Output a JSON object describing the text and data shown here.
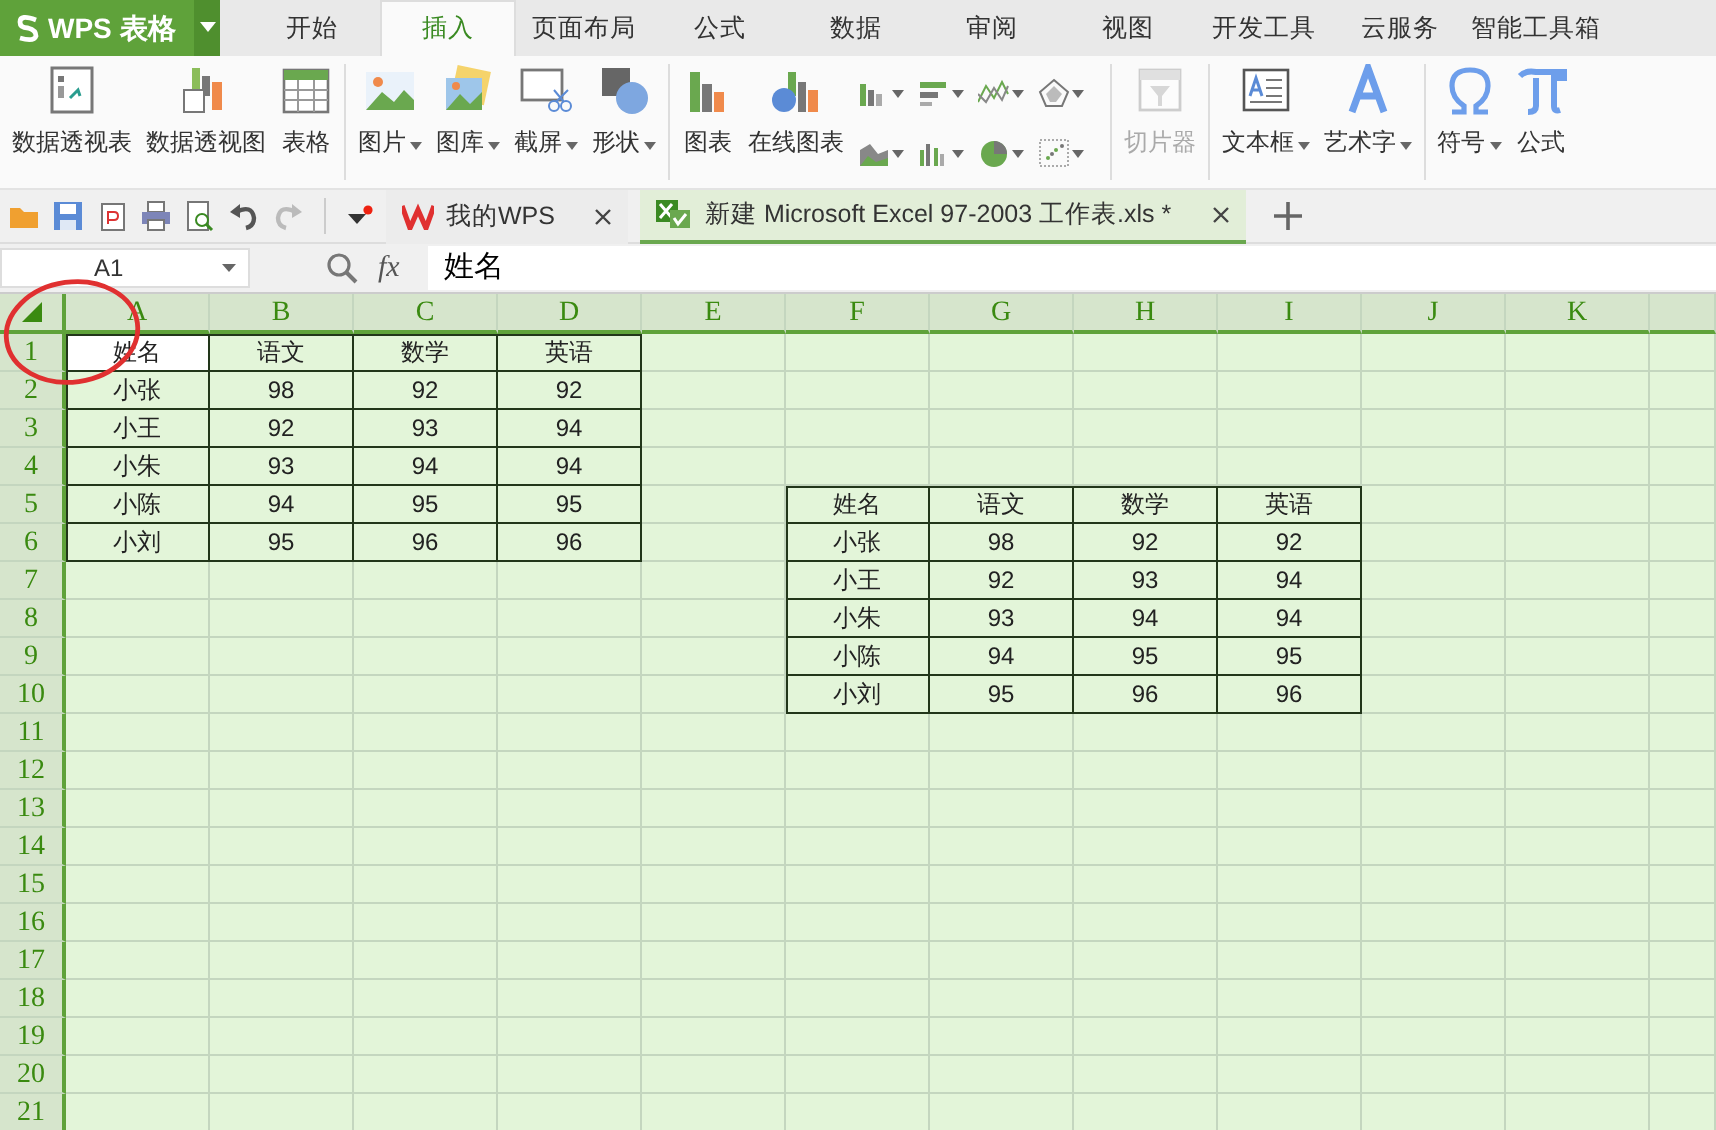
{
  "app_menu": {
    "label": "WPS 表格"
  },
  "ribbon_tabs": [
    {
      "label": "开始",
      "selected": false
    },
    {
      "label": "插入",
      "selected": true
    },
    {
      "label": "页面布局",
      "selected": false
    },
    {
      "label": "公式",
      "selected": false
    },
    {
      "label": "数据",
      "selected": false
    },
    {
      "label": "审阅",
      "selected": false
    },
    {
      "label": "视图",
      "selected": false
    },
    {
      "label": "开发工具",
      "selected": false
    },
    {
      "label": "云服务",
      "selected": false
    },
    {
      "label": "智能工具箱",
      "selected": false
    }
  ],
  "ribbon_groups": [
    {
      "kind": "plain",
      "buttons": [
        {
          "label": "数据透视表",
          "dropdown": false,
          "disabled": false
        },
        {
          "label": "数据透视图",
          "dropdown": false,
          "disabled": false
        },
        {
          "label": "表格",
          "dropdown": false,
          "disabled": false
        }
      ]
    },
    {
      "kind": "plain",
      "buttons": [
        {
          "label": "图片",
          "dropdown": true,
          "disabled": false
        },
        {
          "label": "图库",
          "dropdown": true,
          "disabled": false
        },
        {
          "label": "截屏",
          "dropdown": true,
          "disabled": false
        },
        {
          "label": "形状",
          "dropdown": true,
          "disabled": false
        }
      ]
    },
    {
      "kind": "charts",
      "buttons": [
        {
          "label": "图表",
          "dropdown": false,
          "disabled": false
        },
        {
          "label": "在线图表",
          "dropdown": false,
          "disabled": false
        }
      ]
    },
    {
      "kind": "plain",
      "buttons": [
        {
          "label": "切片器",
          "dropdown": false,
          "disabled": true
        }
      ]
    },
    {
      "kind": "plain",
      "buttons": [
        {
          "label": "文本框",
          "dropdown": true,
          "disabled": false
        },
        {
          "label": "艺术字",
          "dropdown": true,
          "disabled": false
        }
      ]
    },
    {
      "kind": "plain",
      "buttons": [
        {
          "label": "符号",
          "dropdown": true,
          "disabled": false
        },
        {
          "label": "公式",
          "dropdown": false,
          "disabled": false
        }
      ]
    }
  ],
  "document_tabs": [
    {
      "label": "我的WPS",
      "selected": false
    },
    {
      "label": "新建 Microsoft Excel 97-2003 工作表.xls *",
      "selected": true
    }
  ],
  "formula_bar": {
    "name_box": "A1",
    "function_label": "fx",
    "formula": "姓名"
  },
  "sheet": {
    "columns": [
      "A",
      "B",
      "C",
      "D",
      "E",
      "F",
      "G",
      "H",
      "I",
      "J",
      "K"
    ],
    "rows": [
      {
        "header": "1",
        "cells": {
          "A": "姓名",
          "B": "语文",
          "C": "数学",
          "D": "英语"
        }
      },
      {
        "header": "2",
        "cells": {
          "A": "小张",
          "B": "98",
          "C": "92",
          "D": "92"
        }
      },
      {
        "header": "3",
        "cells": {
          "A": "小王",
          "B": "92",
          "C": "93",
          "D": "94"
        }
      },
      {
        "header": "4",
        "cells": {
          "A": "小朱",
          "B": "93",
          "C": "94",
          "D": "94"
        }
      },
      {
        "header": "5",
        "cells": {
          "A": "小陈",
          "B": "94",
          "C": "95",
          "D": "95",
          "F": "姓名",
          "G": "语文",
          "H": "数学",
          "I": "英语"
        }
      },
      {
        "header": "6",
        "cells": {
          "A": "小刘",
          "B": "95",
          "C": "96",
          "D": "96",
          "F": "小张",
          "G": "98",
          "H": "92",
          "I": "92"
        }
      },
      {
        "header": "7",
        "cells": {
          "F": "小王",
          "G": "92",
          "H": "93",
          "I": "94"
        }
      },
      {
        "header": "8",
        "cells": {
          "F": "小朱",
          "G": "93",
          "H": "94",
          "I": "94"
        }
      },
      {
        "header": "9",
        "cells": {
          "F": "小陈",
          "G": "94",
          "H": "95",
          "I": "95"
        }
      },
      {
        "header": "10",
        "cells": {
          "F": "小刘",
          "G": "95",
          "H": "96",
          "I": "96"
        }
      },
      {
        "header": "11"
      },
      {
        "header": "12"
      },
      {
        "header": "13"
      },
      {
        "header": "14"
      },
      {
        "header": "15"
      },
      {
        "header": "16"
      },
      {
        "header": "17"
      },
      {
        "header": "18"
      },
      {
        "header": "19"
      },
      {
        "header": "20"
      },
      {
        "header": "21"
      }
    ]
  },
  "annotation": {
    "kind": "circle"
  }
}
